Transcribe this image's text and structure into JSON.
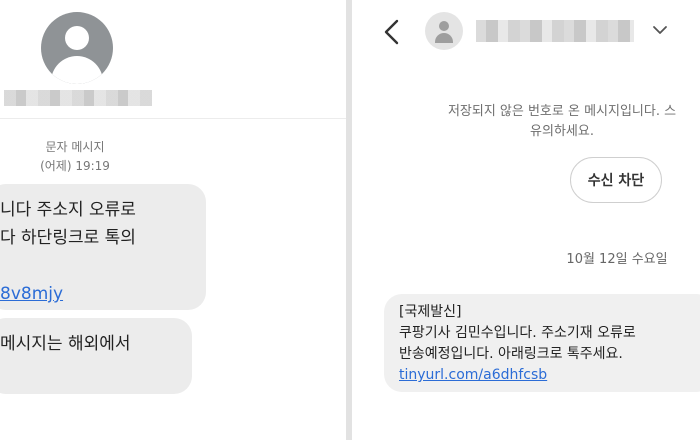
{
  "left_panel": {
    "meta": {
      "label": "문자 메시지",
      "time": "(어제) 19:19"
    },
    "bubble1": {
      "line1": "니다 주소지 오류로",
      "line2": "다 하단링크로 톡의",
      "link": "8v8mjy"
    },
    "bubble2": {
      "line1": "메시지는 해외에서"
    }
  },
  "right_panel": {
    "notice_line1": "저장되지 않은 번호로 온 메시지입니다. 스",
    "notice_line2": "유의하세요.",
    "block_button": "수신 차단",
    "date": "10월 12일 수요일",
    "message": {
      "line1": "[국제발신]",
      "line2": "쿠팡기사 김민수입니다. 주소기재 오류로",
      "line3": "반송예정입니다. 아래링크로 톡주세요.",
      "link": "tinyurl.com/a6dhfcsb"
    }
  },
  "icons": {
    "back": "back-arrow-icon",
    "chevron": "chevron-down-icon",
    "avatar": "default-avatar-icon"
  },
  "colors": {
    "link": "#2b6cd6",
    "bubble": "#ececec",
    "avatar": "#8f9396"
  }
}
